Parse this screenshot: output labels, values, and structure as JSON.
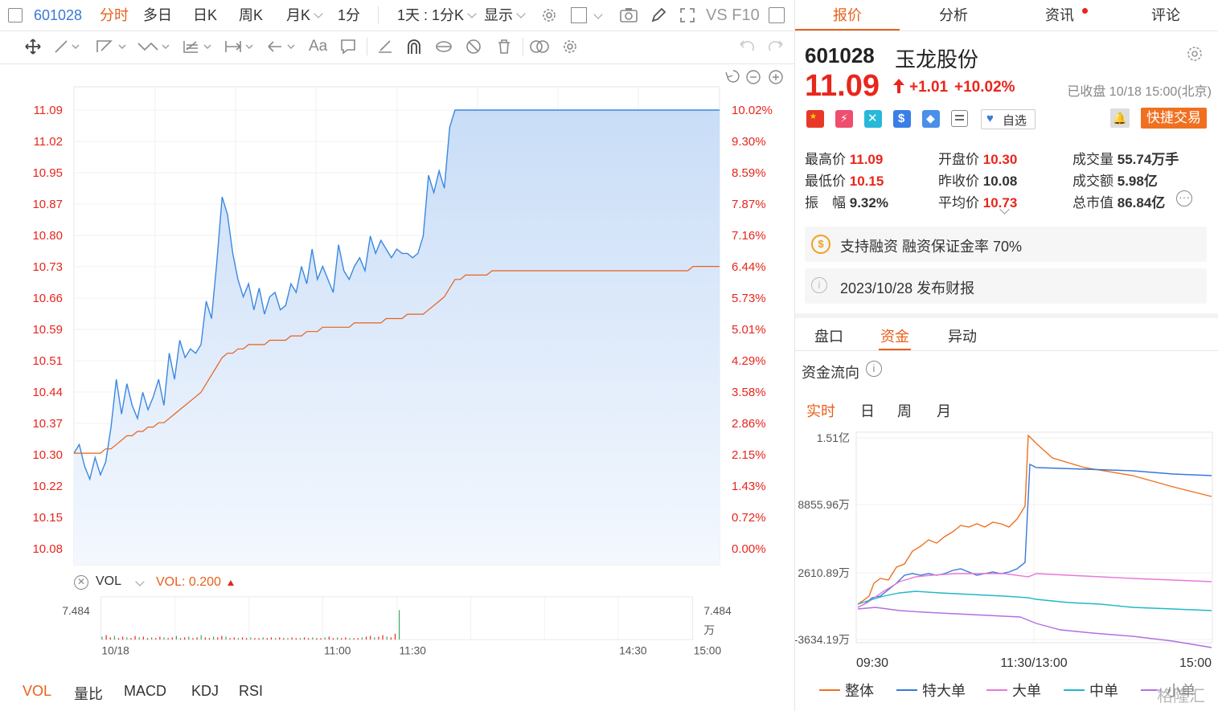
{
  "toolbar": {
    "code": "601028",
    "tabs": [
      "分时",
      "多日",
      "日K",
      "周K",
      "月K",
      "1分",
      "1天 : 1分K",
      "显示"
    ],
    "active_tab": "分时",
    "vs_f10": "VS F10"
  },
  "chart": {
    "price_labels": [
      "11.09",
      "11.02",
      "10.95",
      "10.87",
      "10.80",
      "10.73",
      "10.66",
      "10.59",
      "10.51",
      "10.44",
      "10.37",
      "10.30",
      "10.22",
      "10.15",
      "10.08"
    ],
    "pct_labels": [
      "10.02%",
      "9.30%",
      "8.59%",
      "7.87%",
      "7.16%",
      "6.44%",
      "5.73%",
      "5.01%",
      "4.29%",
      "3.58%",
      "2.86%",
      "2.15%",
      "1.43%",
      "0.72%",
      "0.00%"
    ],
    "price_series": [
      10.3,
      10.32,
      10.27,
      10.24,
      10.29,
      10.25,
      10.28,
      10.36,
      10.47,
      10.39,
      10.46,
      10.41,
      10.38,
      10.44,
      10.4,
      10.43,
      10.47,
      10.41,
      10.53,
      10.47,
      10.56,
      10.52,
      10.54,
      10.53,
      10.55,
      10.65,
      10.61,
      10.74,
      10.89,
      10.85,
      10.76,
      10.7,
      10.66,
      10.69,
      10.63,
      10.68,
      10.62,
      10.66,
      10.67,
      10.63,
      10.64,
      10.69,
      10.67,
      10.73,
      10.69,
      10.77,
      10.7,
      10.73,
      10.7,
      10.67,
      10.78,
      10.72,
      10.7,
      10.73,
      10.75,
      10.72,
      10.8,
      10.76,
      10.79,
      10.77,
      10.75,
      10.77,
      10.76,
      10.76,
      10.75,
      10.76,
      10.8,
      10.94,
      10.9,
      10.95,
      10.91,
      11.05,
      11.09,
      11.09,
      11.09,
      11.09,
      11.09,
      11.09,
      11.09,
      11.09,
      11.09,
      11.09,
      11.09,
      11.09,
      11.09,
      11.09,
      11.09,
      11.09,
      11.09,
      11.09,
      11.09,
      11.09,
      11.09,
      11.09,
      11.09,
      11.09,
      11.09,
      11.09,
      11.09,
      11.09,
      11.09,
      11.09,
      11.09,
      11.09,
      11.09,
      11.09,
      11.09,
      11.09,
      11.09,
      11.09,
      11.09,
      11.09,
      11.09,
      11.09,
      11.09,
      11.09,
      11.09,
      11.09,
      11.09,
      11.09,
      11.09,
      11.09,
      11.09
    ],
    "avg_series": [
      10.3,
      10.3,
      10.3,
      10.3,
      10.3,
      10.3,
      10.31,
      10.31,
      10.32,
      10.33,
      10.34,
      10.34,
      10.35,
      10.35,
      10.36,
      10.36,
      10.37,
      10.37,
      10.38,
      10.39,
      10.4,
      10.41,
      10.42,
      10.43,
      10.44,
      10.46,
      10.48,
      10.5,
      10.52,
      10.53,
      10.53,
      10.54,
      10.54,
      10.55,
      10.55,
      10.55,
      10.55,
      10.56,
      10.56,
      10.56,
      10.56,
      10.57,
      10.57,
      10.57,
      10.58,
      10.58,
      10.58,
      10.59,
      10.59,
      10.59,
      10.59,
      10.59,
      10.59,
      10.6,
      10.6,
      10.6,
      10.6,
      10.6,
      10.6,
      10.61,
      10.61,
      10.61,
      10.61,
      10.62,
      10.62,
      10.62,
      10.62,
      10.63,
      10.64,
      10.65,
      10.66,
      10.68,
      10.7,
      10.7,
      10.71,
      10.71,
      10.71,
      10.71,
      10.71,
      10.72,
      10.72,
      10.72,
      10.72,
      10.72,
      10.72,
      10.72,
      10.72,
      10.72,
      10.72,
      10.72,
      10.72,
      10.72,
      10.72,
      10.72,
      10.72,
      10.72,
      10.72,
      10.72,
      10.72,
      10.72,
      10.72,
      10.72,
      10.72,
      10.72,
      10.72,
      10.72,
      10.72,
      10.72,
      10.72,
      10.72,
      10.72,
      10.72,
      10.72,
      10.72,
      10.72,
      10.72,
      10.72,
      10.73,
      10.73,
      10.73,
      10.73,
      10.73,
      10.73
    ]
  },
  "vol": {
    "label": "VOL",
    "value_label": "VOL: 0.200",
    "max_label": "7.484",
    "unit": "万",
    "x_labels": [
      "10/18",
      "11:00",
      "11:30",
      "14:30",
      "15:00"
    ]
  },
  "bottom_tabs": [
    "VOL",
    "量比",
    "MACD",
    "KDJ",
    "RSI"
  ],
  "right": {
    "tabs": [
      "报价",
      "分析",
      "资讯",
      "评论"
    ],
    "stock_code": "601028",
    "stock_name": "玉龙股份",
    "price": "11.09",
    "change": "+1.01",
    "change_pct": "+10.02%",
    "status": "已收盘 10/18 15:00(北京)",
    "watch_label": "自选",
    "quick_trade": "快捷交易",
    "stats": [
      {
        "label": "最高价",
        "value": "11.09",
        "color": "red"
      },
      {
        "label": "开盘价",
        "value": "10.30",
        "color": "red"
      },
      {
        "label": "成交量",
        "value": "55.74万手",
        "color": "dark"
      },
      {
        "label": "最低价",
        "value": "10.15",
        "color": "red"
      },
      {
        "label": "昨收价",
        "value": "10.08",
        "color": "dark"
      },
      {
        "label": "成交额",
        "value": "5.98亿",
        "color": "dark"
      },
      {
        "label": "振　幅",
        "value": "9.32%",
        "color": "dark"
      },
      {
        "label": "平均价",
        "value": "10.73",
        "color": "red"
      },
      {
        "label": "总市值",
        "value": "86.84亿",
        "color": "dark"
      }
    ],
    "margin_info": "支持融资 融资保证金率 70%",
    "report_info": "2023/10/28  发布财报",
    "sub_tabs": [
      "盘口",
      "资金",
      "异动"
    ],
    "flow_title": "资金流向",
    "period_tabs": [
      "实时",
      "日",
      "周",
      "月"
    ],
    "flow_y_labels": [
      "1.51亿",
      "8855.96万",
      "2610.89万",
      "-3634.19万"
    ],
    "flow_x_labels": [
      "09:30",
      "11:30/13:00",
      "15:00"
    ],
    "legend": [
      {
        "name": "整体",
        "color": "#f07020"
      },
      {
        "name": "特大单",
        "color": "#3a78d8"
      },
      {
        "name": "大单",
        "color": "#e878d8"
      },
      {
        "name": "中单",
        "color": "#20b8c8"
      },
      {
        "name": "小单",
        "color": "#b070e0"
      }
    ],
    "watermark": "格隆汇"
  },
  "colors": {
    "accent": "#e8601c",
    "up": "#e8261c",
    "price_line": "#3a88e0",
    "avg_line": "#e8601c"
  }
}
